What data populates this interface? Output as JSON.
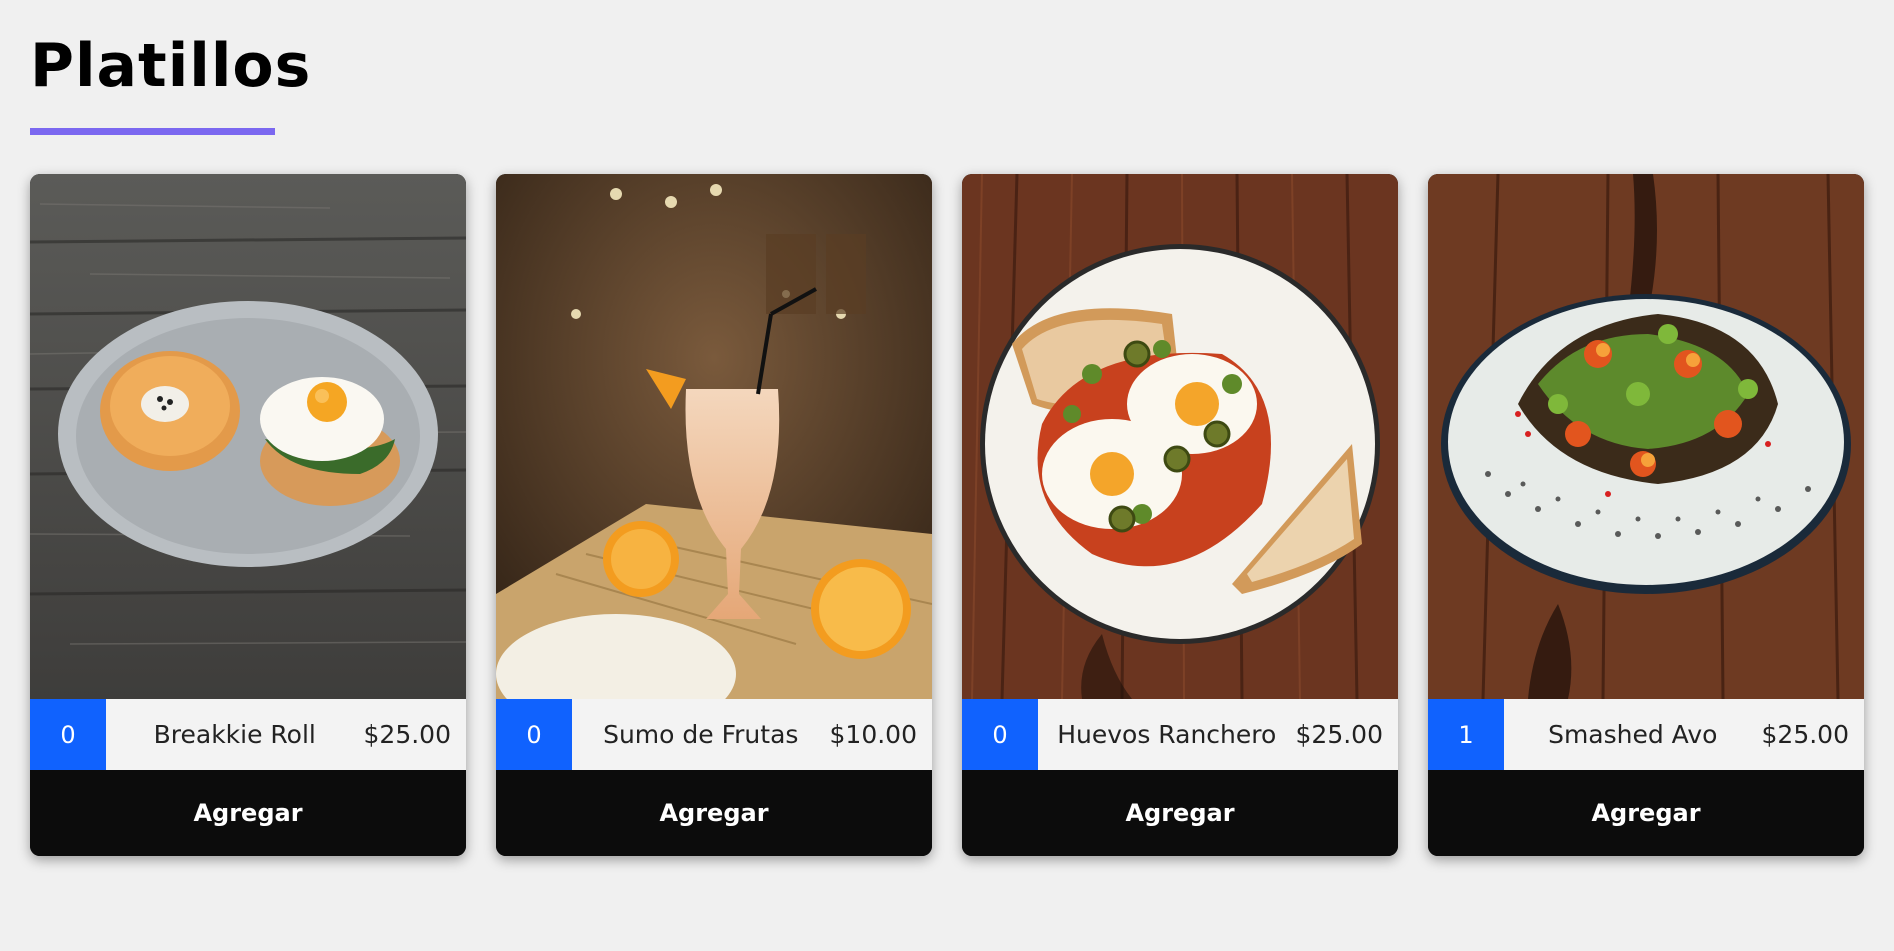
{
  "page": {
    "title": "Platillos"
  },
  "colors": {
    "accent": "#7b68f0",
    "badge": "#1062fe",
    "button": "#0c0c0c",
    "background": "#f0f0f0"
  },
  "cards": [
    {
      "image": "breakfast-roll-with-egg-photo",
      "quantity": "0",
      "name": "Breakkie Roll",
      "price": "$25.00",
      "button_label": "Agregar"
    },
    {
      "image": "fruit-smoothie-glass-photo",
      "quantity": "0",
      "name": "Sumo de Frutas",
      "price": "$10.00",
      "button_label": "Agregar"
    },
    {
      "image": "huevos-rancheros-plate-photo",
      "quantity": "0",
      "name": "Huevos Ranchero",
      "price": "$25.00",
      "button_label": "Agregar"
    },
    {
      "image": "smashed-avocado-salad-photo",
      "quantity": "1",
      "name": "Smashed Avo",
      "price": "$25.00",
      "button_label": "Agregar"
    }
  ]
}
